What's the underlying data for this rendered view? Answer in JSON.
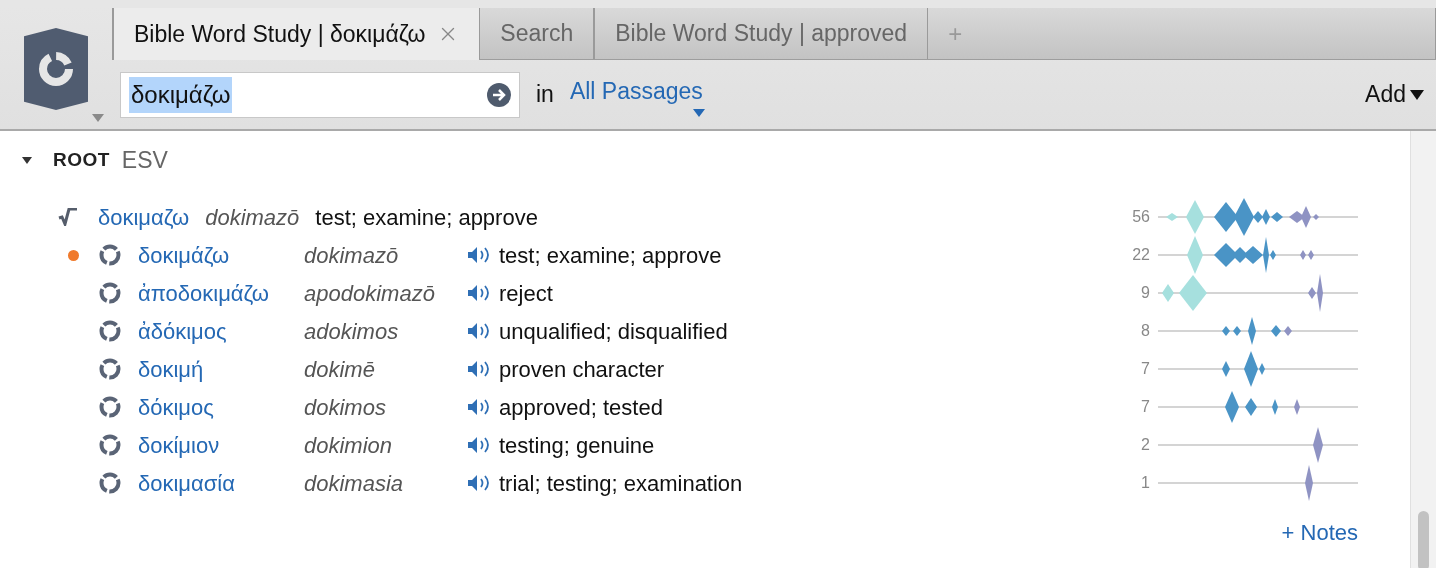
{
  "tabs": [
    {
      "label": "Bible Word Study | δοκιμάζω",
      "selected": true
    },
    {
      "label": "Search",
      "selected": false
    },
    {
      "label": "Bible Word Study | approved",
      "selected": false
    }
  ],
  "new_tab": "+",
  "search": {
    "value": "δοκιμάζω",
    "text_selected": true
  },
  "scope": {
    "label": "in",
    "link": "All Passages"
  },
  "add_menu": "Add",
  "section": {
    "label": "ROOT",
    "version": "ESV",
    "expanded": true
  },
  "root": {
    "lemma": "δοκιμαζω",
    "translit": "dokimazō",
    "gloss": "test; examine; approve",
    "count": "56"
  },
  "words": [
    {
      "lemma": "δοκιμάζω",
      "translit": "dokimazō",
      "gloss": "test; examine; approve",
      "count": "22",
      "marked": true
    },
    {
      "lemma": "ἀποδοκιμάζω",
      "translit": "apodokimazō",
      "gloss": "reject",
      "count": "9",
      "marked": false
    },
    {
      "lemma": "ἀδόκιμος",
      "translit": "adokimos",
      "gloss": "unqualified; disqualified",
      "count": "8",
      "marked": false
    },
    {
      "lemma": "δοκιμή",
      "translit": "dokimē",
      "gloss": "proven character",
      "count": "7",
      "marked": false
    },
    {
      "lemma": "δόκιμος",
      "translit": "dokimos",
      "gloss": "approved; tested",
      "count": "7",
      "marked": false
    },
    {
      "lemma": "δοκίμιον",
      "translit": "dokimion",
      "gloss": "testing; genuine",
      "count": "2",
      "marked": false
    },
    {
      "lemma": "δοκιμασία",
      "translit": "dokimasia",
      "gloss": "trial; testing; examination",
      "count": "1",
      "marked": false
    }
  ],
  "notes_link": "+ Notes"
}
